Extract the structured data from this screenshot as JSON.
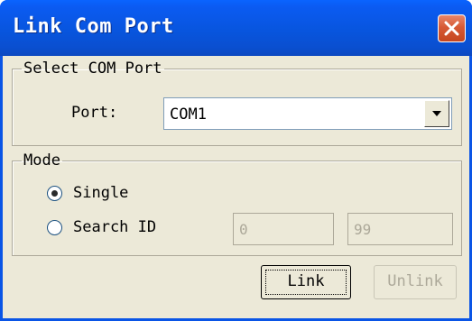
{
  "window": {
    "title": "Link Com Port",
    "close_icon": "close-icon"
  },
  "com_group": {
    "legend": "Select COM Port",
    "port_label": "Port:",
    "port_value": "COM1",
    "dropdown_icon": "chevron-down-icon"
  },
  "mode_group": {
    "legend": "Mode",
    "single_label": "Single",
    "single_selected": true,
    "search_label": "Search ID",
    "search_selected": false,
    "search_from": "0",
    "search_to": "99"
  },
  "buttons": {
    "link_label": "Link",
    "unlink_label": "Unlink",
    "unlink_enabled": false
  },
  "colors": {
    "titlebar": "#0855de",
    "client_bg": "#ece9d8",
    "close_button": "#d75a36",
    "disabled_text": "#aca899",
    "radio_dot": "#21a121"
  }
}
